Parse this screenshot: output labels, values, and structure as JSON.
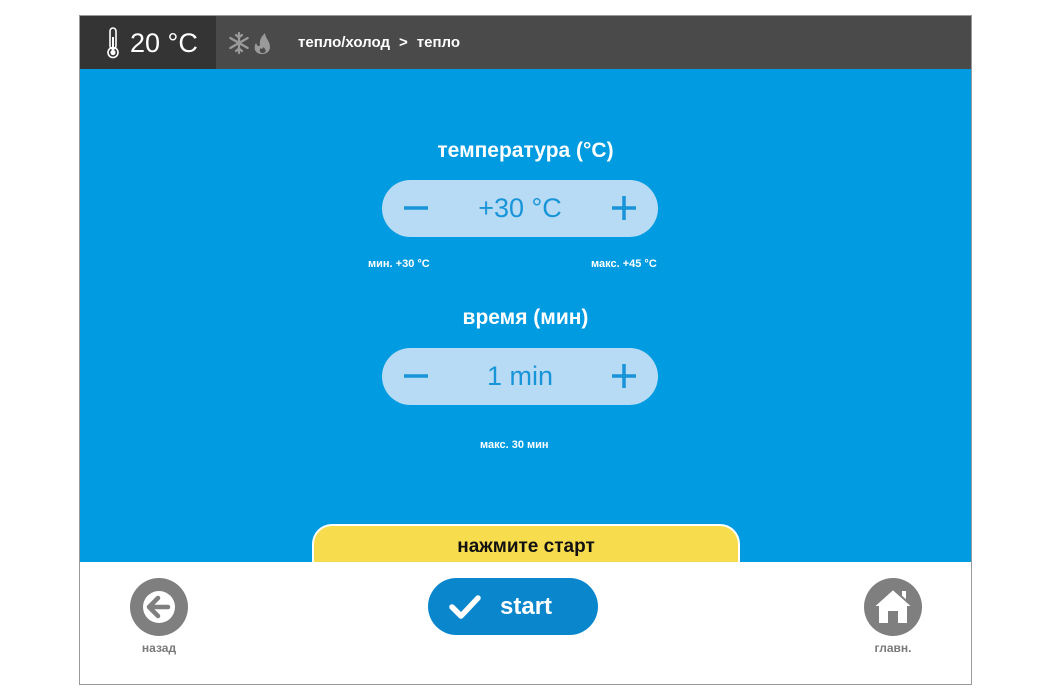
{
  "header": {
    "current_temperature": "20 °C",
    "breadcrumb": {
      "parent": "тепло/холод",
      "separator": ">",
      "current": "тепло"
    },
    "icons": [
      "thermometer-icon",
      "snowflake-icon",
      "flame-icon"
    ]
  },
  "temperature": {
    "label": "температура (°C)",
    "value": "+30 °C",
    "min_hint": "мин. +30 °C",
    "max_hint": "макс. +45 °C"
  },
  "time": {
    "label": "время (мин)",
    "value": "1 min",
    "max_hint": "макс. 30 мин"
  },
  "banner": {
    "text": "нажмите старт"
  },
  "footer": {
    "back_label": "назад",
    "start_label": "start",
    "home_label": "главн."
  },
  "colors": {
    "main_bg": "#009be0",
    "header_bg": "#4a4a4a",
    "stepper_bg": "#b8dbf5",
    "accent_blue": "#1894d8",
    "banner_yellow": "#f7dc4d",
    "start_button": "#0a86cc",
    "nav_button": "#7f7f7f"
  }
}
